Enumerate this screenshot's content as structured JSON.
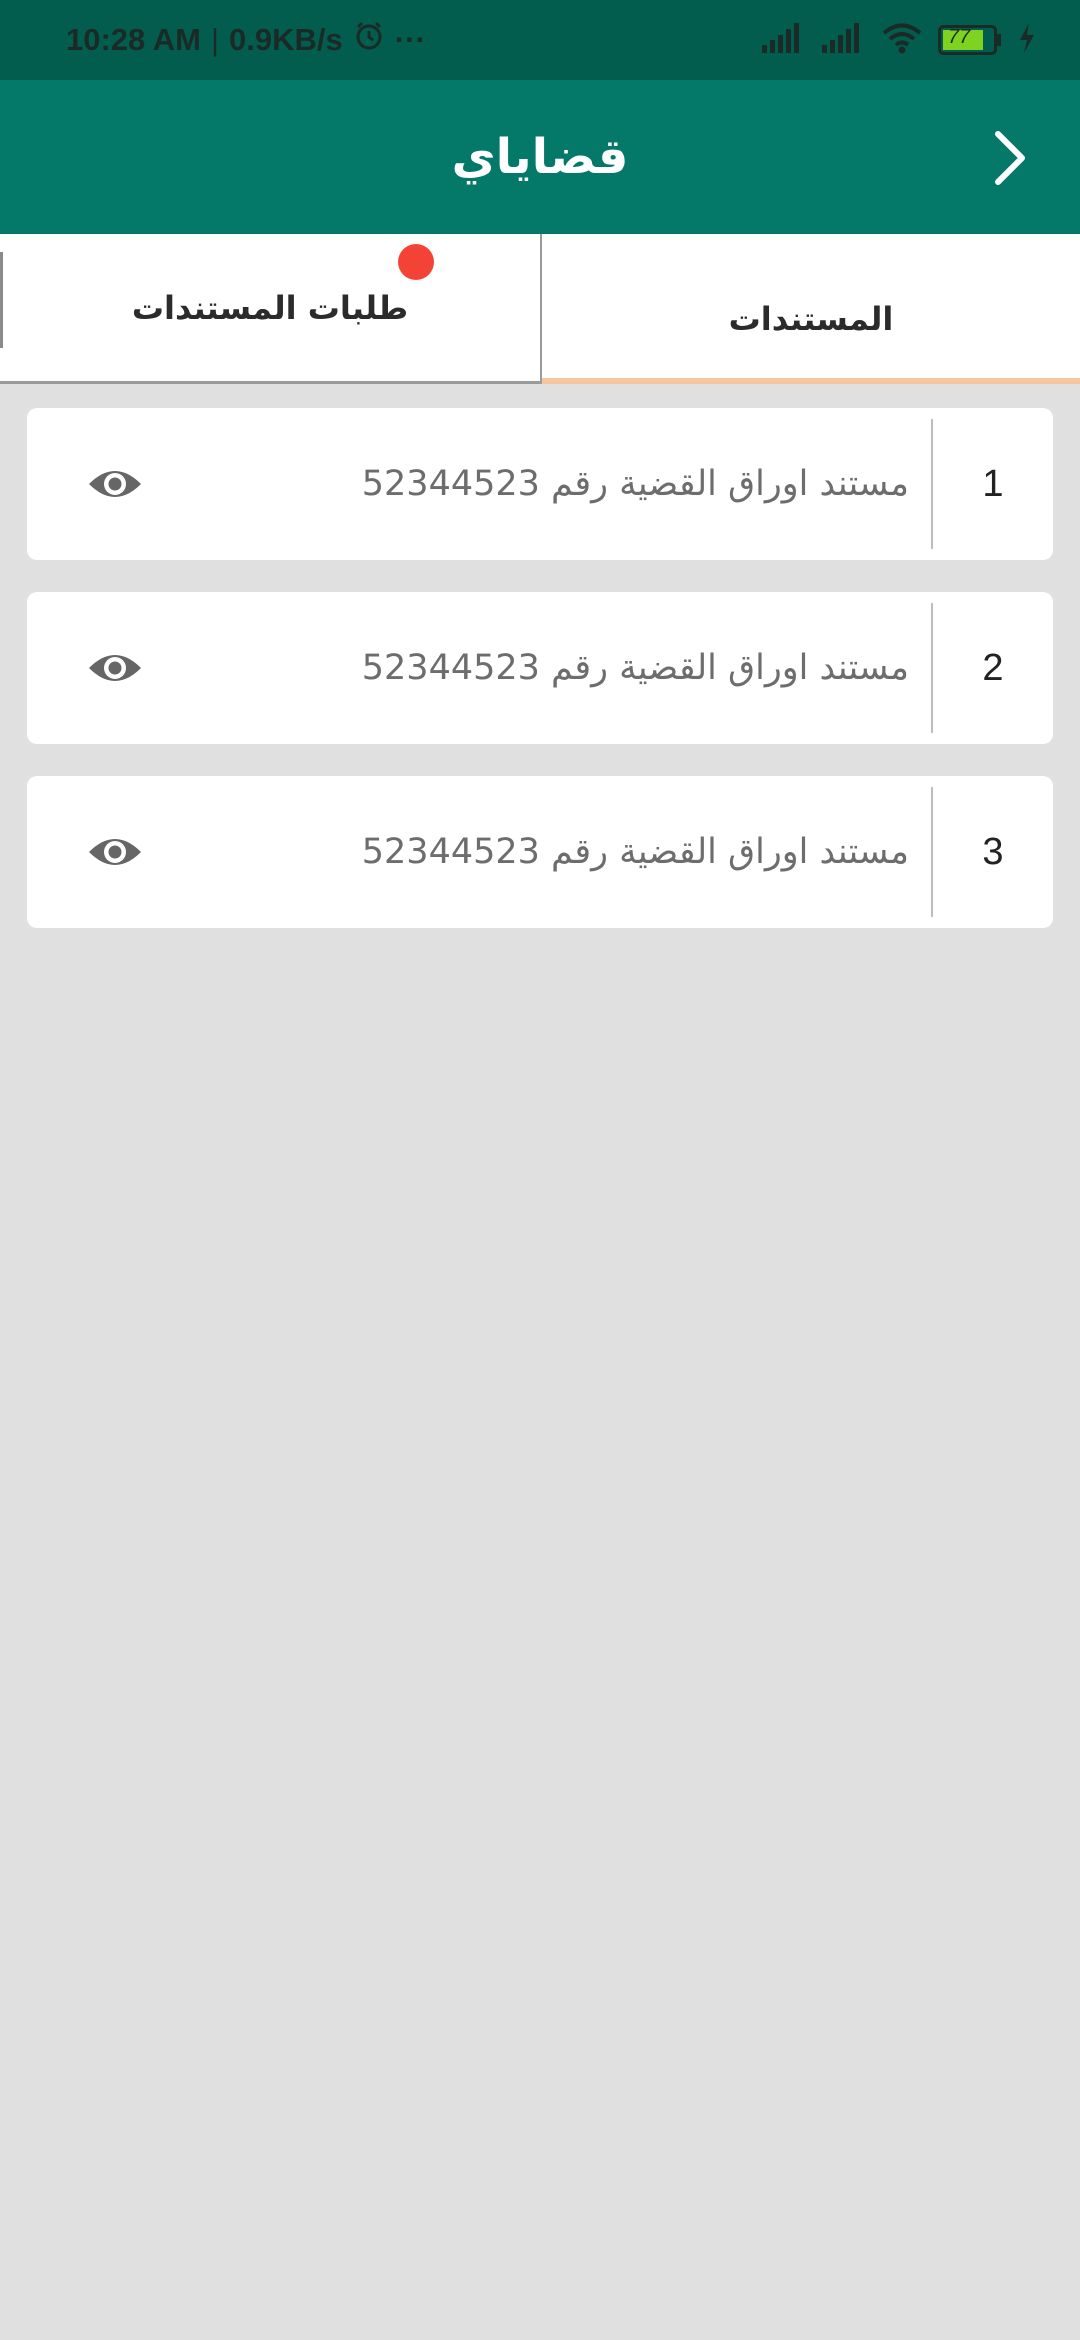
{
  "status_bar": {
    "time": "10:28 AM",
    "separator": "|",
    "network_speed": "0.9KB/s",
    "more": "···",
    "battery": "77"
  },
  "app_bar": {
    "title": "قضاياي",
    "back_icon": "chevron-right-icon"
  },
  "tabs": [
    {
      "label": "المستندات",
      "selected": true
    },
    {
      "label": "طلبات المستندات",
      "selected": false,
      "has_badge": true
    }
  ],
  "documents": [
    {
      "number": "1",
      "title": "مستند اوراق القضية رقم 52344523",
      "action_icon": "eye-icon"
    },
    {
      "number": "2",
      "title": "مستند اوراق القضية رقم 52344523",
      "action_icon": "eye-icon"
    },
    {
      "number": "3",
      "title": "مستند اوراق القضية رقم 52344523",
      "action_icon": "eye-icon"
    }
  ],
  "colors": {
    "status_bar": "#035d4f",
    "app_bar": "#04796a",
    "tab_indicator": "#f6c6a1",
    "badge": "#f44336",
    "background": "#e0e0e0"
  }
}
